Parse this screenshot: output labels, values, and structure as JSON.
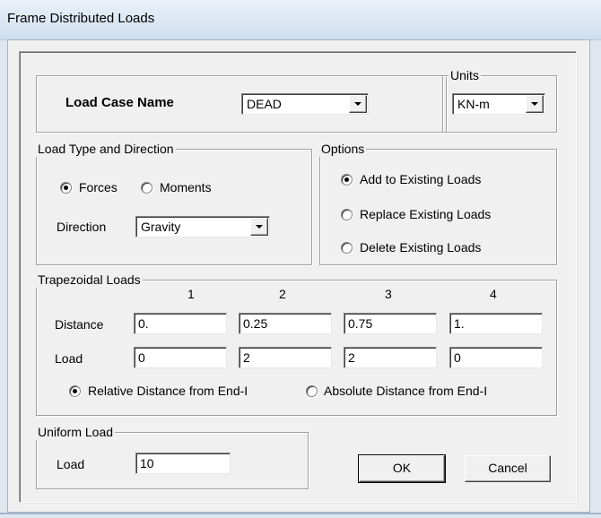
{
  "window": {
    "title": "Frame Distributed Loads"
  },
  "load_case": {
    "label": "Load Case Name",
    "value": "DEAD"
  },
  "units": {
    "legend": "Units",
    "value": "KN-m"
  },
  "load_type": {
    "legend": "Load Type and Direction",
    "forces_label": "Forces",
    "moments_label": "Moments",
    "selected": "Forces",
    "direction_label": "Direction",
    "direction_value": "Gravity"
  },
  "options": {
    "legend": "Options",
    "add_label": "Add to Existing Loads",
    "replace_label": "Replace Existing Loads",
    "delete_label": "Delete Existing Loads",
    "selected": "Add to Existing Loads"
  },
  "trapezoidal": {
    "legend": "Trapezoidal Loads",
    "columns": [
      "1",
      "2",
      "3",
      "4"
    ],
    "distance_label": "Distance",
    "distances": [
      "0.",
      "0.25",
      "0.75",
      "1."
    ],
    "load_label": "Load",
    "loads": [
      "0",
      "2",
      "2",
      "0"
    ],
    "relative_label": "Relative Distance from End-I",
    "absolute_label": "Absolute Distance from End-I",
    "selected": "Relative Distance from End-I"
  },
  "uniform": {
    "legend": "Uniform Load",
    "load_label": "Load",
    "value": "10"
  },
  "buttons": {
    "ok": "OK",
    "cancel": "Cancel"
  }
}
